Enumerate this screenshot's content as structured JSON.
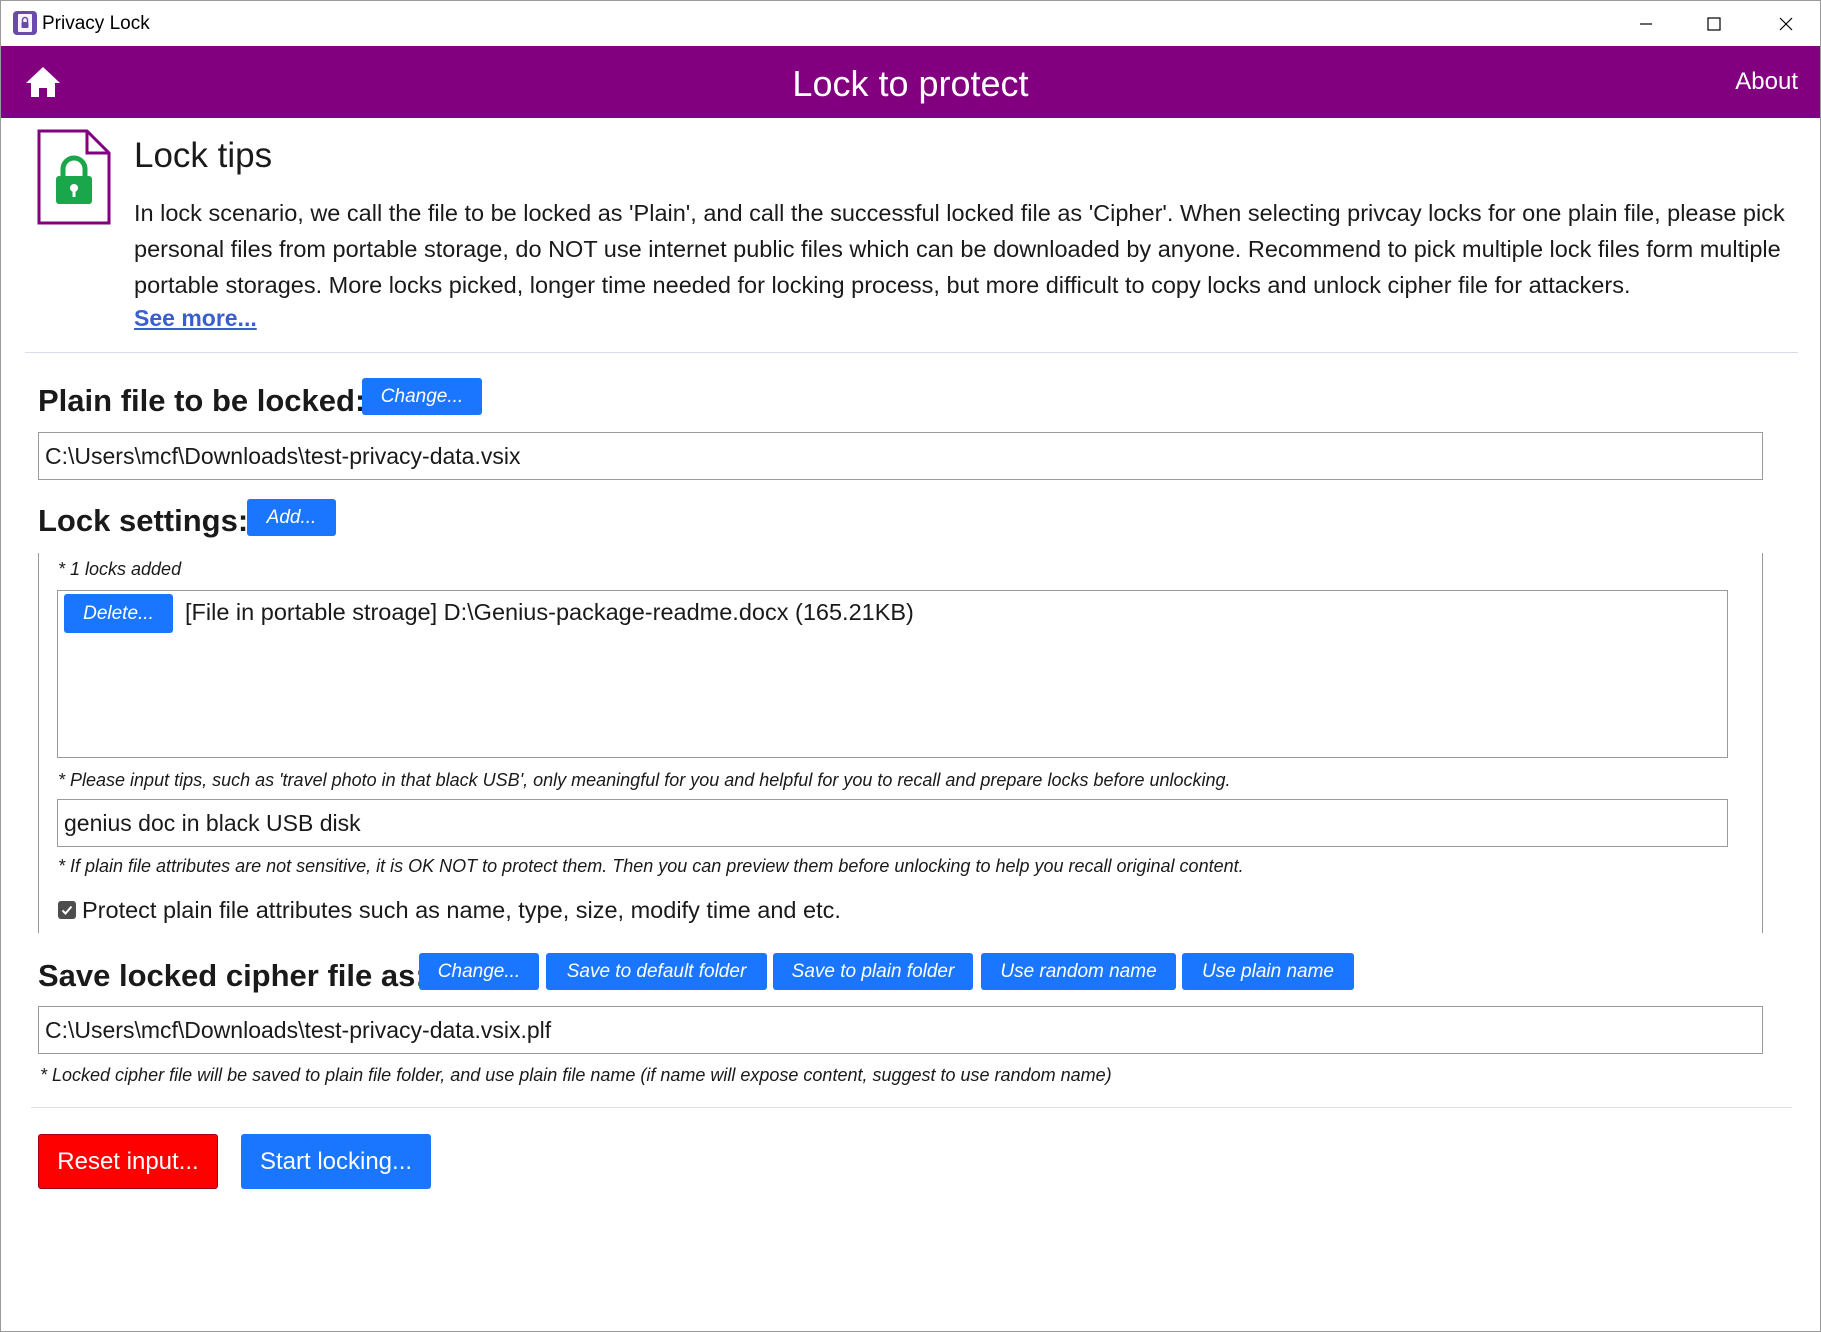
{
  "window": {
    "title": "Privacy Lock",
    "controls": [
      "minimize",
      "maximize",
      "close"
    ]
  },
  "header": {
    "title": "Lock to protect",
    "about_label": "About",
    "home_icon": "home-icon",
    "background_color": "#820080"
  },
  "tips": {
    "title": "Lock tips",
    "body": "In lock scenario, we call the file to be locked as 'Plain', and call the successful locked file as 'Cipher'. When selecting privcay locks for one plain file, please pick personal files from portable storage, do NOT use internet public files which can be downloaded by anyone. Recommend to pick multiple lock files form multiple portable storages. More locks picked, longer time needed for locking process, but more difficult to copy locks and unlock cipher file for attackers.",
    "see_more_label": "See more...",
    "icon": "locked-document-icon"
  },
  "plain_file": {
    "label": "Plain file to be locked:",
    "change_label": "Change...",
    "path": "C:\\Users\\mcf\\Downloads\\test-privacy-data.vsix"
  },
  "lock_settings": {
    "label": "Lock settings:",
    "add_label": "Add...",
    "locks_count_note": "* 1 locks added",
    "locks": [
      {
        "delete_label": "Delete...",
        "description": "[File in portable stroage] D:\\Genius-package-readme.docx (165.21KB)"
      }
    ],
    "tips_note": "* Please input tips, such as 'travel photo in that black USB', only meaningful for you and helpful for you to recall and prepare locks before unlocking.",
    "tips_value": "genius doc in black USB disk",
    "attributes_note": "* If plain file attributes are not sensitive, it is OK NOT to protect them. Then you can preview them before unlocking to help you recall original content.",
    "protect_attributes_label": "Protect plain file attributes such as name, type, size, modify time and etc.",
    "protect_attributes_checked": true
  },
  "save_cipher": {
    "label": "Save locked cipher file as:",
    "buttons": {
      "change": "Change...",
      "default_folder": "Save to default folder",
      "plain_folder": "Save to plain folder",
      "random_name": "Use random name",
      "plain_name": "Use plain name"
    },
    "path": "C:\\Users\\mcf\\Downloads\\test-privacy-data.vsix.plf",
    "note": "* Locked cipher file will be saved to plain file folder, and use plain file name (if name will expose content, suggest to use random name)"
  },
  "actions": {
    "reset_label": "Reset input...",
    "start_label": "Start locking...",
    "reset_color": "#ff0000",
    "start_color": "#1a75ff"
  }
}
